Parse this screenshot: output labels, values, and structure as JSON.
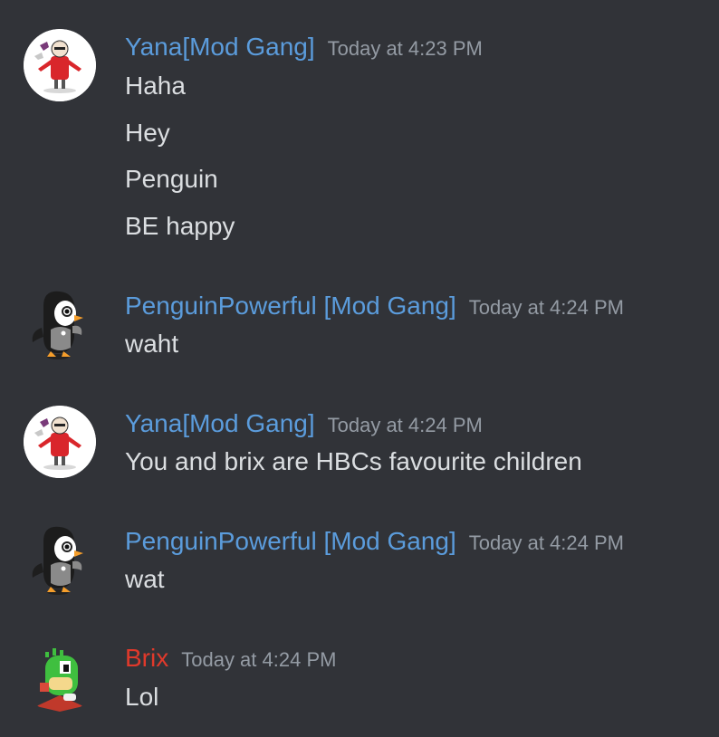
{
  "colors": {
    "background": "#313338",
    "username_blue": "#5b9cdc",
    "username_red": "#e0392b",
    "text": "#dbdee1",
    "timestamp": "#949ba4"
  },
  "messages": [
    {
      "author": "Yana[Mod Gang]",
      "timestamp": "Today at 4:23 PM",
      "avatar_icon": "yana-avatar-icon",
      "lines": [
        "Haha",
        "Hey",
        "Penguin",
        "BE happy"
      ]
    },
    {
      "author": "PenguinPowerful [Mod Gang]",
      "timestamp": "Today at 4:24 PM",
      "avatar_icon": "penguin-avatar-icon",
      "lines": [
        "waht"
      ]
    },
    {
      "author": "Yana[Mod Gang]",
      "timestamp": "Today at 4:24 PM",
      "avatar_icon": "yana-avatar-icon",
      "lines": [
        "You and brix are HBCs favourite children"
      ]
    },
    {
      "author": "PenguinPowerful [Mod Gang]",
      "timestamp": "Today at 4:24 PM",
      "avatar_icon": "penguin-avatar-icon",
      "lines": [
        "wat"
      ]
    },
    {
      "author": "Brix",
      "timestamp": "Today at 4:24 PM",
      "avatar_icon": "dragon-avatar-icon",
      "lines": [
        "Lol"
      ]
    }
  ]
}
